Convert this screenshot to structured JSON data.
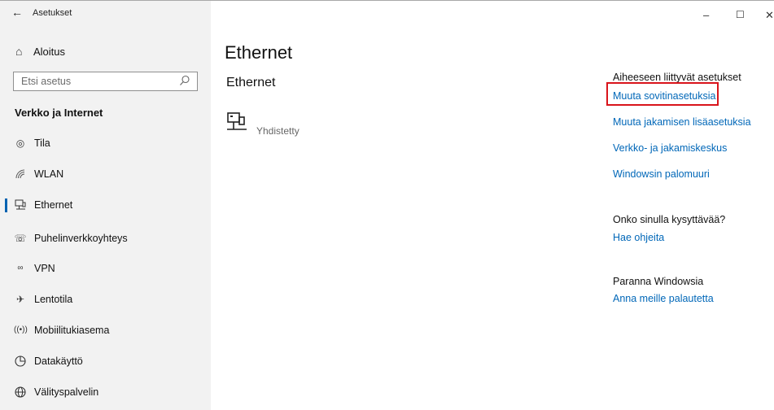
{
  "app": {
    "title": "Asetukset"
  },
  "window_controls": {
    "minimize": "–",
    "maximize": "☐",
    "close": "✕"
  },
  "sidebar": {
    "home_label": "Aloitus",
    "search_placeholder": "Etsi asetus",
    "section_title": "Verkko ja Internet",
    "selected_item": "Ethernet",
    "items": [
      {
        "label": "Tila",
        "icon": "globe-status-icon"
      },
      {
        "label": "WLAN",
        "icon": "wifi-icon"
      },
      {
        "label": "Ethernet",
        "icon": "ethernet-icon"
      },
      {
        "label": "Puhelinverkkoyhteys",
        "icon": "dialup-icon"
      },
      {
        "label": "VPN",
        "icon": "vpn-icon"
      },
      {
        "label": "Lentotila",
        "icon": "airplane-icon"
      },
      {
        "label": "Mobiilitukiasema",
        "icon": "hotspot-icon"
      },
      {
        "label": "Datakäyttö",
        "icon": "data-usage-icon"
      },
      {
        "label": "Välityspalvelin",
        "icon": "proxy-globe-icon"
      }
    ]
  },
  "main": {
    "page_title": "Ethernet",
    "sub_title": "Ethernet",
    "connection_status": "Yhdistetty"
  },
  "related": {
    "title": "Aiheeseen liittyvät asetukset",
    "links": [
      "Muuta sovitinasetuksia",
      "Muuta jakamisen lisäasetuksia",
      "Verkko- ja jakamiskeskus",
      "Windowsin palomuuri"
    ],
    "highlighted_link": "Muuta sovitinasetuksia",
    "highlight_color": "#d9141b",
    "help_title": "Onko sinulla kysyttävää?",
    "help_link": "Hae ohjeita",
    "feedback_title": "Paranna Windowsia",
    "feedback_link": "Anna meille palautetta"
  },
  "colors": {
    "accent": "#0067b8",
    "sidebar_bg": "#f2f2f2",
    "selection_bar": "#0063b1"
  }
}
